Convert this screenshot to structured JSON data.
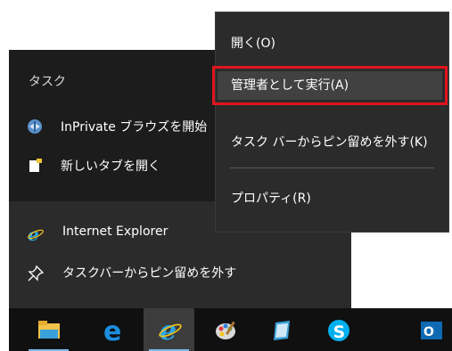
{
  "jump_list": {
    "section_title": "タスク",
    "tasks": [
      {
        "label": "InPrivate ブラウズを開始",
        "icon": "inprivate-icon"
      },
      {
        "label": "新しいタブを開く",
        "icon": "new-tab-icon"
      }
    ],
    "app_item": {
      "label": "Internet Explorer",
      "icon": "internet-explorer-icon"
    },
    "unpin_item": {
      "label": "タスクバーからピン留めを外す",
      "icon": "unpin-icon"
    }
  },
  "context_menu": {
    "items": [
      {
        "label": "開く(O)"
      },
      {
        "label": "管理者として実行(A)",
        "highlighted": true
      },
      {
        "label": "タスク バーからピン留めを外す(K)"
      },
      {
        "label": "プロパティ(R)"
      }
    ],
    "highlight_color": "#e3141e"
  },
  "taskbar": {
    "buttons": [
      {
        "icon": "file-explorer-icon"
      },
      {
        "icon": "edge-icon"
      },
      {
        "icon": "internet-explorer-icon",
        "active": true
      },
      {
        "icon": "paint-icon"
      },
      {
        "icon": "notes-icon"
      },
      {
        "icon": "skype-icon"
      },
      {
        "icon": "outlook-icon"
      }
    ],
    "accent_color": "#76b9ed"
  }
}
